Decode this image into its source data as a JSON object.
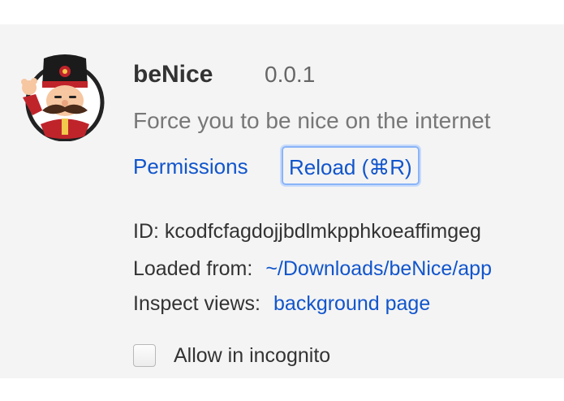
{
  "extension": {
    "name": "beNice",
    "version": "0.0.1",
    "description": "Force you to be nice on the internet",
    "icon": "beefeater-guard-avatar-icon"
  },
  "links": {
    "permissions": "Permissions",
    "reload": "Reload (⌘R)"
  },
  "details": {
    "id": "ID: kcodfcfagdojjbdlmkpphkoeaffimgeg",
    "loaded_from_label": "Loaded from:",
    "loaded_from_path": "~/Downloads/beNice/app",
    "inspect_views_label": "Inspect views:",
    "inspect_views_link": "background page"
  },
  "incognito": {
    "label": "Allow in incognito",
    "checked": false
  },
  "colors": {
    "link": "#1155cc",
    "card_background": "#f4f4f4",
    "focus_ring": "#8ab4f8"
  }
}
